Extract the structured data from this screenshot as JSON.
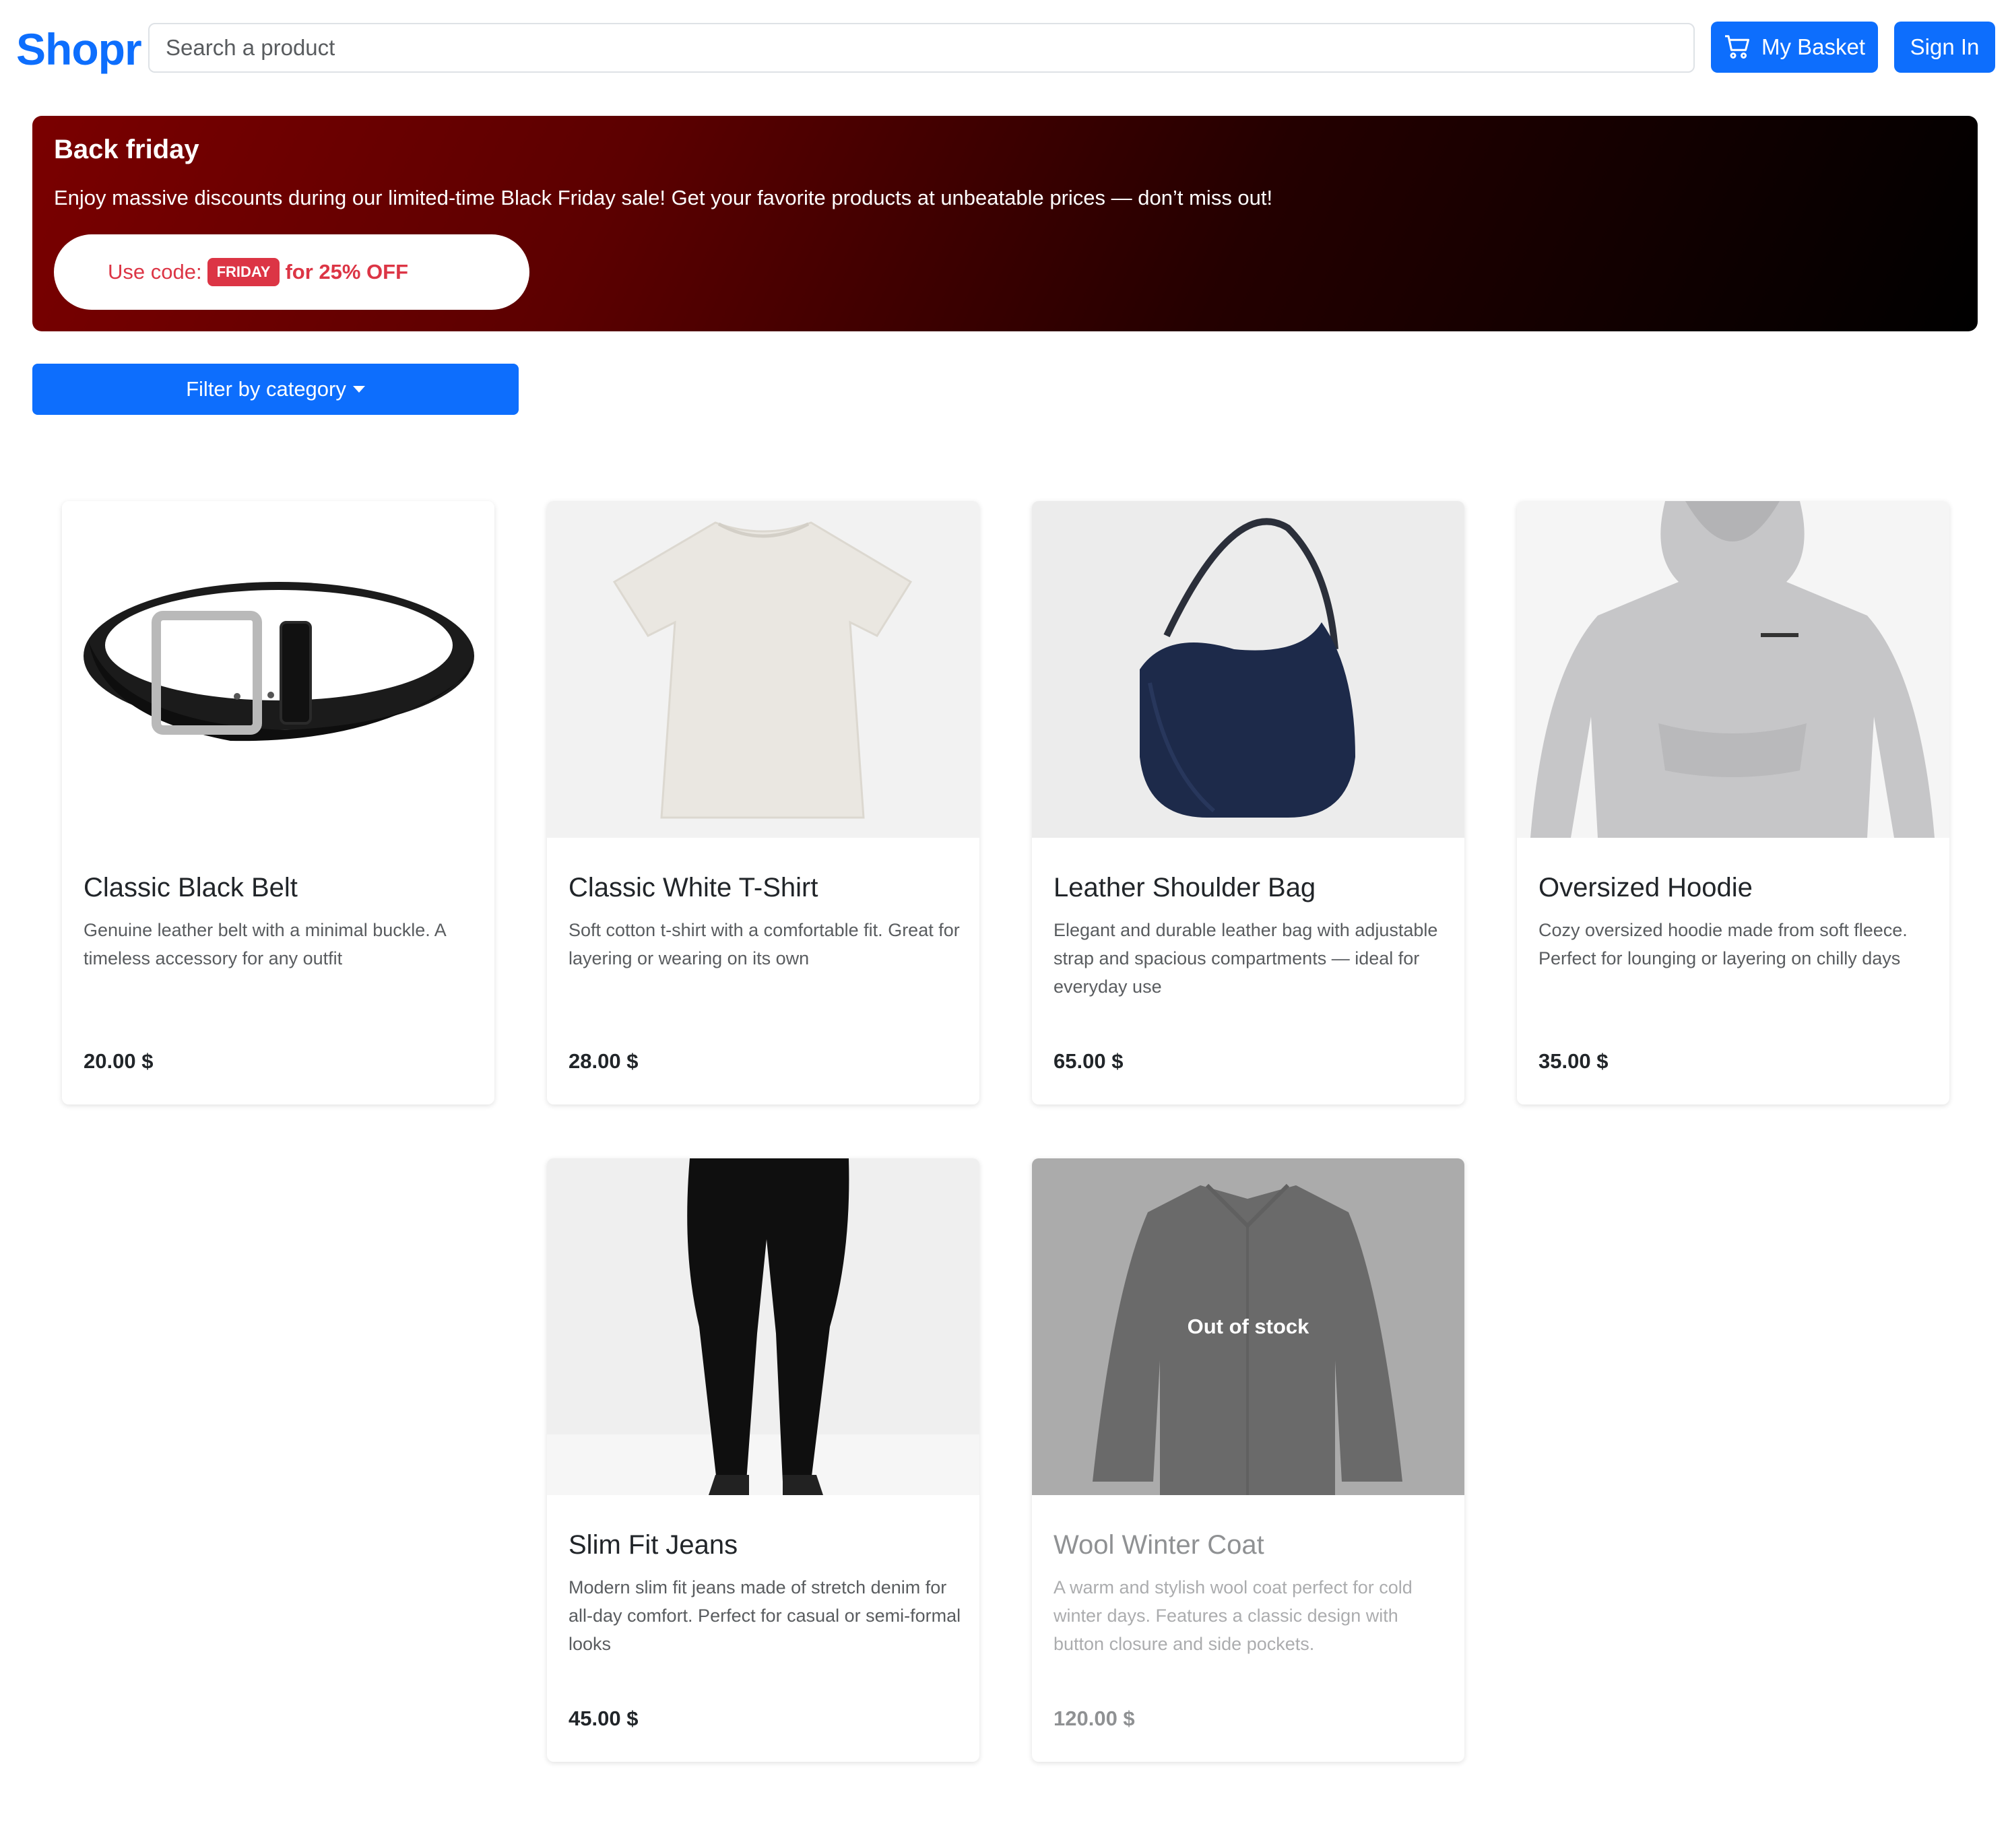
{
  "header": {
    "brand": "Shopr",
    "search_placeholder": "Search a product",
    "basket_label": "My Basket",
    "signin_label": "Sign In",
    "accent": "#0d6efd"
  },
  "banner": {
    "title": "Back friday",
    "text": "Enjoy massive discounts during our limited-time Black Friday sale! Get your favorite products at unbeatable prices — don’t miss out!",
    "promo_prefix": "Use code:",
    "promo_code": "FRIDAY",
    "promo_suffix": "for 25% OFF"
  },
  "filter": {
    "label": "Filter by category"
  },
  "products": [
    {
      "name": "Classic Black Belt",
      "description": "Genuine leather belt with a minimal buckle. A timeless accessory for any outfit",
      "price": "20.00 $",
      "image_icon": "belt-image"
    },
    {
      "name": "Classic White T-Shirt",
      "description": "Soft cotton t-shirt with a comfortable fit. Great for layering or wearing on its own",
      "price": "28.00 $",
      "image_icon": "tshirt-image"
    },
    {
      "name": "Leather Shoulder Bag",
      "description": "Elegant and durable leather bag with adjustable strap and spacious compartments — ideal for everyday use",
      "price": "65.00 $",
      "image_icon": "bag-image"
    },
    {
      "name": "Oversized Hoodie",
      "description": "Cozy oversized hoodie made from soft fleece. Perfect for lounging or layering on chilly days",
      "price": "35.00 $",
      "image_icon": "hoodie-image"
    },
    {
      "name": "Slim Fit Jeans",
      "description": "Modern slim fit jeans made of stretch denim for all-day comfort. Perfect for casual or semi-formal looks",
      "price": "45.00 $",
      "image_icon": "jeans-image"
    },
    {
      "name": "Wool Winter Coat",
      "description": "A warm and stylish wool coat perfect for cold winter days. Features a classic design with button closure and side pockets.",
      "price": "120.00 $",
      "image_icon": "coat-image",
      "status": "Out of stock"
    }
  ]
}
